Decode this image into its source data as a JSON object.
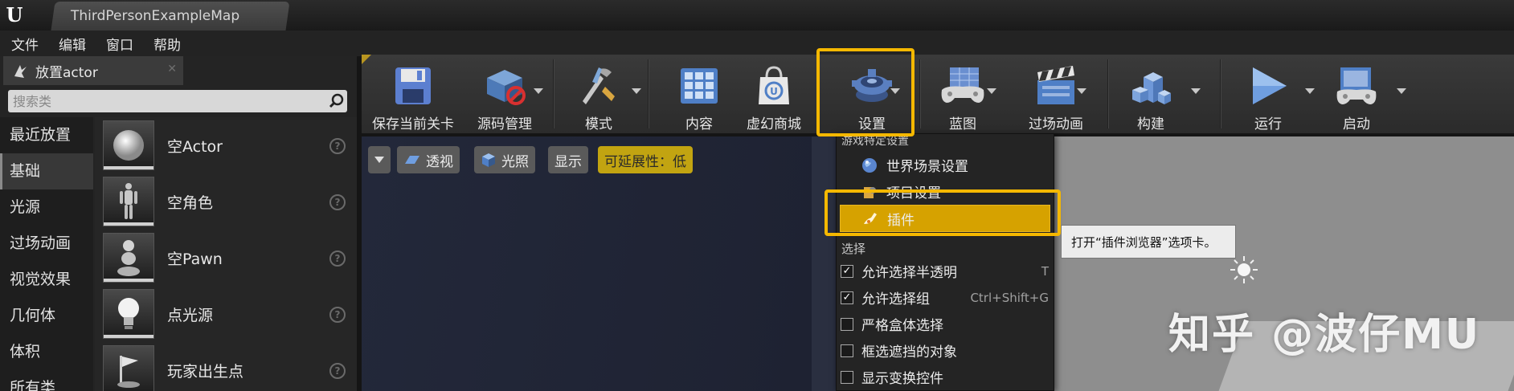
{
  "window": {
    "tab_title": "ThirdPersonExampleMap"
  },
  "menubar": [
    "文件",
    "编辑",
    "窗口",
    "帮助"
  ],
  "place_panel": {
    "tab_label": "放置actor",
    "search_placeholder": "搜索类",
    "categories": [
      "最近放置",
      "基础",
      "光源",
      "过场动画",
      "视觉效果",
      "几何体",
      "体积",
      "所有类"
    ],
    "active_category": "基础",
    "actors": [
      "空Actor",
      "空角色",
      "空Pawn",
      "点光源",
      "玩家出生点"
    ]
  },
  "toolbar": {
    "save": "保存当前关卡",
    "source_control": "源码管理",
    "modes": "模式",
    "content": "内容",
    "marketplace": "虚幻商城",
    "settings": "设置",
    "blueprints": "蓝图",
    "cinematics": "过场动画",
    "build": "构建",
    "play": "运行",
    "launch": "启动"
  },
  "viewport": {
    "perspective": "透视",
    "lit": "光照",
    "show": "显示",
    "scalability": "可延展性：低"
  },
  "settings_menu": {
    "section_game": "游戏特定设置",
    "world_settings": "世界场景设置",
    "project_settings": "项目设置",
    "plugins": "插件",
    "section_selection": "选择",
    "options": [
      {
        "label": "允许选择半透明",
        "checked": true,
        "shortcut": "T"
      },
      {
        "label": "允许选择组",
        "checked": true,
        "shortcut": "Ctrl+Shift+G"
      },
      {
        "label": "严格盒体选择",
        "checked": false,
        "shortcut": ""
      },
      {
        "label": "框选遮挡的对象",
        "checked": false,
        "shortcut": ""
      },
      {
        "label": "显示变换控件",
        "checked": false,
        "shortcut": ""
      }
    ]
  },
  "tooltip": "打开“插件浏览器”选项卡。",
  "watermark": "知乎 @波仔MU",
  "colors": {
    "highlight": "#f5b800",
    "menu_selected": "#d6a200",
    "scalability_badge": "#c2a411"
  }
}
